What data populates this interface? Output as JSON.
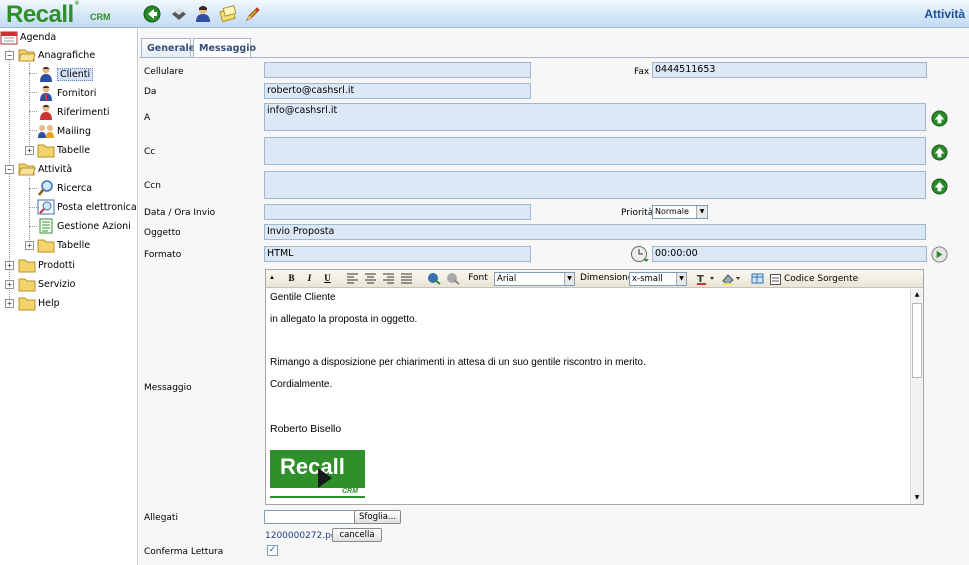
{
  "app": {
    "logo": "Recall",
    "logo_suffix": "CRM",
    "title": "Attività",
    "accent": "#2f8f2a",
    "title_color": "#1f4f96"
  },
  "toolbar": {
    "icons": [
      "back-icon",
      "print-icon",
      "user-icon",
      "notes-icon",
      "pencil-icon"
    ]
  },
  "sidebar": {
    "agenda": "Agenda",
    "anagrafiche": "Anagrafiche",
    "clienti": "Clienti",
    "fornitori": "Fornitori",
    "riferimenti": "Riferimenti",
    "mailing": "Mailing",
    "tabelle1": "Tabelle",
    "attivita": "Attività",
    "ricerca": "Ricerca",
    "posta": "Posta elettronica",
    "gestione": "Gestione Azioni",
    "tabelle2": "Tabelle",
    "prodotti": "Prodotti",
    "servizio": "Servizio",
    "help": "Help"
  },
  "tabs": {
    "generale": "Generale",
    "messaggio": "Messaggio"
  },
  "form": {
    "cellulare_label": "Cellulare",
    "cellulare_value": "",
    "fax_label": "Fax",
    "fax_value": "0444511653",
    "da_label": "Da",
    "da_value": "roberto@cashsrl.it",
    "a_label": "A",
    "a_value": "info@cashsrl.it",
    "cc_label": "Cc",
    "cc_value": "",
    "ccn_label": "Ccn",
    "ccn_value": "",
    "data_label": "Data / Ora Invio",
    "data_value": "",
    "priorita_label": "Priorità",
    "priorita_value": "Normale",
    "oggetto_label": "Oggetto",
    "oggetto_value": "Invio Proposta",
    "formato_label": "Formato",
    "formato_value": "HTML",
    "time_value": "00:00:00",
    "messaggio_label": "Messaggio",
    "allegati_label": "Allegati",
    "browse_button": "Sfoglia...",
    "attachment_name": "1200000272.pdf",
    "cancel_button": "cancella",
    "conferma_label": "Conferma Lettura",
    "conferma_checked": true
  },
  "editor": {
    "bold": "B",
    "italic": "I",
    "underline": "U",
    "font_label": "Font",
    "font_value": "Arial",
    "size_label": "Dimensione",
    "size_value": "x-small",
    "source_label": "Codice Sorgente",
    "body": {
      "line1": "Gentile Cliente",
      "line2": "in allegato la proposta in oggetto.",
      "line3": "Rimango a disposizione per chiarimenti in attesa di un suo gentile riscontro in merito.",
      "line4": "Cordialmente.",
      "signature": "Roberto Bisello",
      "sig_logo": "Recall",
      "sig_logo_sub": "CRM"
    }
  }
}
